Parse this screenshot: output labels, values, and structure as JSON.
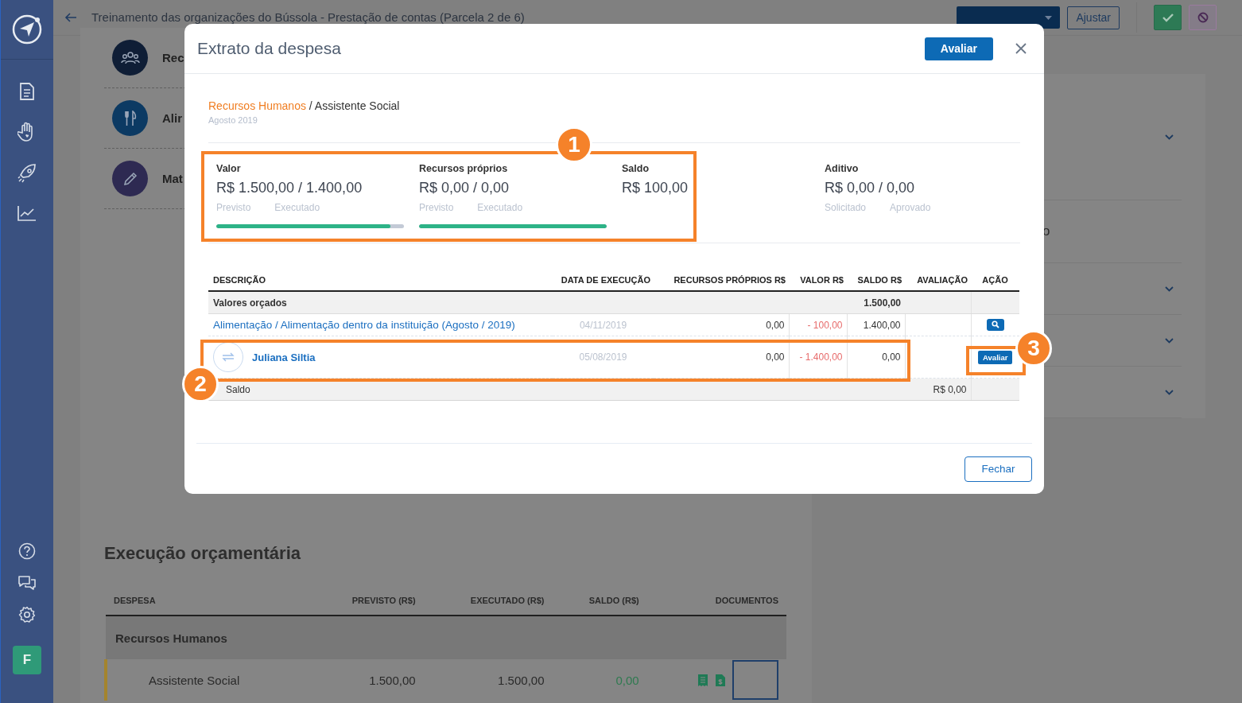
{
  "sidebar": {
    "avatar": "F"
  },
  "header": {
    "title": "Treinamento das organizações do Bússola - Prestação de contas (Parcela 2 de 6)",
    "adjust_button": "Ajustar"
  },
  "background_list": [
    {
      "label": "Rec",
      "kind": "people",
      "color": "#0f1e36"
    },
    {
      "label": "Alir",
      "kind": "food",
      "color": "#0c3a63"
    },
    {
      "label": "Mat",
      "kind": "pencil",
      "color": "#2e2a52"
    }
  ],
  "right_panel": {
    "text": "o"
  },
  "budget": {
    "title": "Execução orçamentária",
    "columns": [
      "DESPESA",
      "PREVISTO (R$)",
      "EXECUTADO (R$)",
      "SALDO (R$)",
      "DOCUMENTOS"
    ],
    "group": "Recursos Humanos",
    "rows": [
      {
        "cells": [
          "Assistente Social",
          "1.500,00",
          "1.500,00",
          "0,00"
        ]
      }
    ]
  },
  "modal": {
    "title": "Extrato da despesa",
    "evaluate_button": "Avaliar",
    "category": "Recursos Humanos",
    "separator": "/",
    "subcategory": "Assistente Social",
    "period": "Agosto 2019",
    "stats": [
      {
        "label": "Valor",
        "value": "R$ 1.500,00 / 1.400,00",
        "sublabels": [
          "Previsto",
          "Executado"
        ],
        "level": 0.93
      },
      {
        "label": "Recursos próprios",
        "value": "R$ 0,00 / 0,00",
        "sublabels": [
          "Previsto",
          "Executado"
        ],
        "level": 1
      },
      {
        "label": "Saldo",
        "value": "R$ 100,00"
      },
      {
        "label": "Aditivo",
        "value": "R$ 0,00 / 0,00",
        "sublabels": [
          "Solicitado",
          "Aprovado"
        ]
      }
    ],
    "columns": [
      "DESCRIÇÃO",
      "DATA DE EXECUÇÃO",
      "RECURSOS PRÓPRIOS R$",
      "VALOR R$",
      "SALDO R$",
      "AVALIAÇÃO",
      "AÇÃO"
    ],
    "rows": [
      {
        "kind": "group",
        "label": "Valores orçados",
        "saldo": "1.500,00"
      },
      {
        "kind": "link",
        "label": "Alimentação / Alimentação dentro da instituição (Agosto / 2019)",
        "date": "04/11/2019",
        "own": "0,00",
        "value": "- 100,00",
        "saldo": "1.400,00",
        "action": {
          "kind": "search"
        }
      },
      {
        "kind": "person",
        "label": "Juliana Siltia",
        "date": "05/08/2019",
        "own": "0,00",
        "value": "- 1.400,00",
        "saldo": "0,00",
        "action": {
          "kind": "button",
          "label": "Avaliar"
        }
      },
      {
        "kind": "total",
        "label": "Saldo",
        "total": "R$ 0,00"
      }
    ],
    "close_button": "Fechar"
  },
  "annotations": [
    {
      "label": "1"
    },
    {
      "label": "2"
    },
    {
      "label": "3"
    }
  ]
}
